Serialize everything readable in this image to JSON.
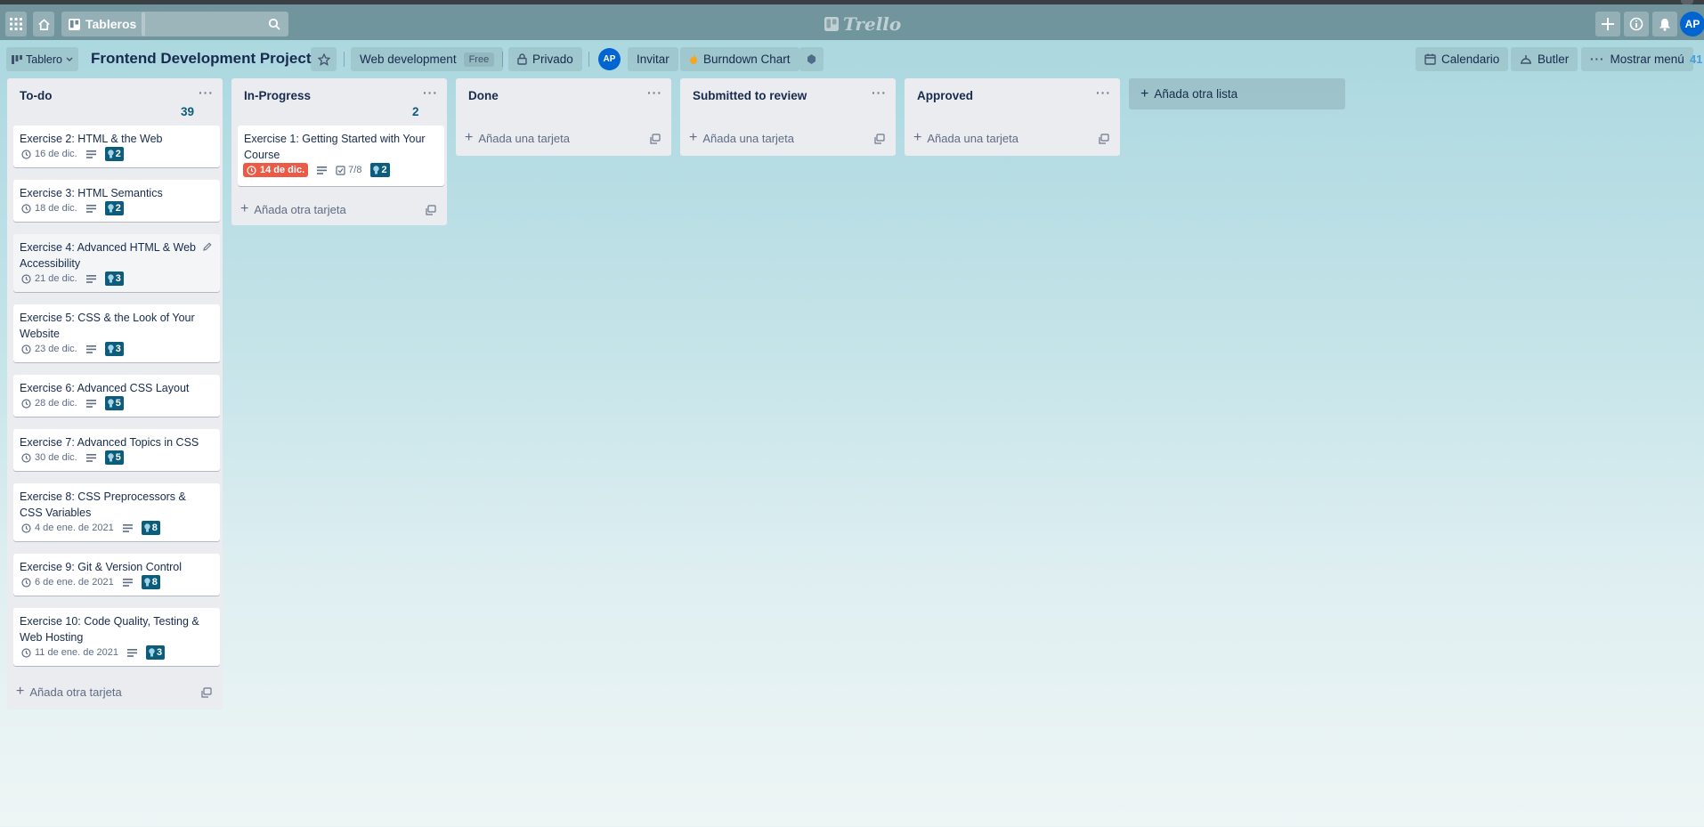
{
  "header": {
    "boards_label": "Tableros",
    "logo_text": "Trello",
    "user_initials": "AP"
  },
  "board": {
    "view_label": "Tablero",
    "title": "Frontend Development Project",
    "workspace_label": "Web development",
    "workspace_plan": "Free",
    "visibility_label": "Privado",
    "member_initials": "AP",
    "invite_label": "Invitar",
    "powerup_label": "Burndown Chart",
    "calendar_label": "Calendario",
    "butler_label": "Butler",
    "menu_label": "Mostrar menú",
    "overflow_count": "41"
  },
  "lists": [
    {
      "title": "To-do",
      "count": "39",
      "cards": [
        {
          "title": "Exercise 2: HTML & the Web",
          "due": "16 de dic.",
          "labels": "2"
        },
        {
          "title": "Exercise 3: HTML Semantics",
          "due": "18 de dic.",
          "labels": "2"
        },
        {
          "title": "Exercise 4: Advanced HTML & Web Accessibility",
          "due": "21 de dic.",
          "labels": "3"
        },
        {
          "title": "Exercise 5: CSS & the Look of Your Website",
          "due": "23 de dic.",
          "labels": "3"
        },
        {
          "title": "Exercise 6: Advanced CSS Layout",
          "due": "28 de dic.",
          "labels": "5"
        },
        {
          "title": "Exercise 7: Advanced Topics in CSS",
          "due": "30 de dic.",
          "labels": "5"
        },
        {
          "title": "Exercise 8: CSS Preprocessors & CSS Variables",
          "due": "4 de ene. de 2021",
          "labels": "8"
        },
        {
          "title": "Exercise 9: Git & Version Control",
          "due": "6 de ene. de 2021",
          "labels": "8"
        },
        {
          "title": "Exercise 10: Code Quality, Testing & Web Hosting",
          "due": "11 de ene. de 2021",
          "labels": "3"
        }
      ],
      "add_label": "Añada otra tarjeta"
    },
    {
      "title": "In-Progress",
      "count": "2",
      "cards": [
        {
          "title": "Exercise 1: Getting Started with Your Course",
          "due": "14 de dic.",
          "checklist": "7/8",
          "labels": "2"
        }
      ],
      "add_label": "Añada otra tarjeta"
    },
    {
      "title": "Done",
      "add_label": "Añada una tarjeta"
    },
    {
      "title": "Submitted to review",
      "add_label": "Añada una tarjeta"
    },
    {
      "title": "Approved",
      "add_label": "Añada una tarjeta"
    }
  ],
  "add_list_label": "Añada otra lista",
  "colors": {
    "header_bg": "#4e6c74",
    "label_badge": "#0c5c7c",
    "overdue": "#eb5a46",
    "avatar": "#0065d1"
  },
  "icons": [
    "apps-icon",
    "home-icon",
    "boards-icon",
    "search-icon",
    "trello-logo-icon",
    "plus-icon",
    "info-icon",
    "bell-icon",
    "star-icon",
    "lock-icon",
    "fire-icon",
    "calendar-icon",
    "butler-icon",
    "clock-icon",
    "description-icon",
    "checklist-icon",
    "card-template-icon",
    "pencil-icon"
  ]
}
